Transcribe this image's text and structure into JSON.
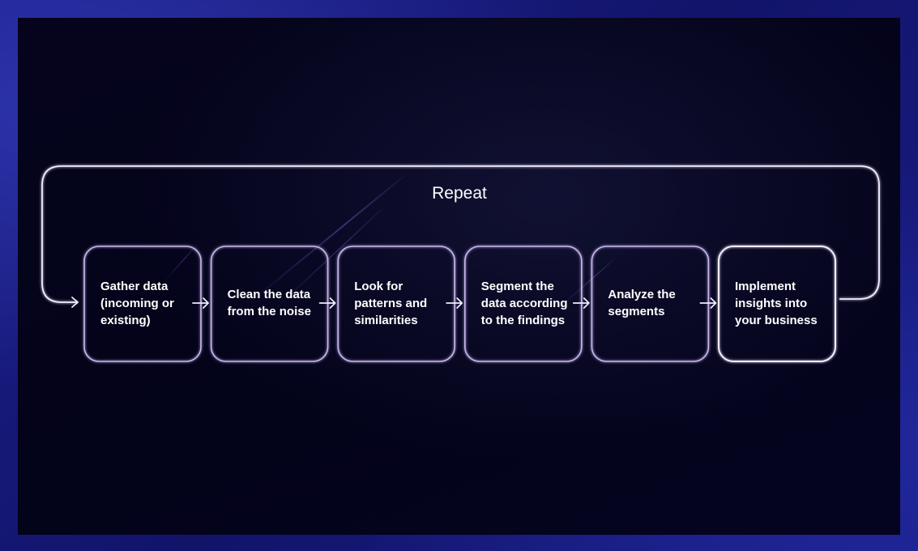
{
  "diagram": {
    "loop_label": "Repeat",
    "steps": [
      {
        "label": "Gather data\n(incoming or\nexisting)"
      },
      {
        "label": "Clean the data\nfrom the noise"
      },
      {
        "label": "Look for\npatterns and\nsimilarities"
      },
      {
        "label": "Segment the\ndata according\nto the findings"
      },
      {
        "label": "Analyze the\nsegments"
      },
      {
        "label": "Implement\ninsights into\nyour business"
      }
    ],
    "colors": {
      "background_outer": "#171a78",
      "background_panel": "#04031a",
      "box_stroke": "#c9b7ee",
      "box_stroke_highlight": "#f2ecff",
      "text": "#ffffff"
    }
  }
}
